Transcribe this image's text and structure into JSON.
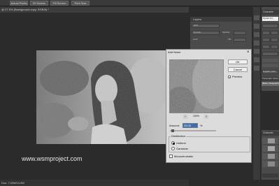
{
  "toolbar": {
    "buttons": [
      "Actual Pixels",
      "Fit Screen",
      "Fill Screen",
      "Print Size"
    ]
  },
  "document": {
    "tab_title": "@ 27.5% (Background copy, RGB/8) *",
    "status": "Doc: 7.02M/14.0M",
    "watermark": "www.wsmproject.com"
  },
  "layers_panel": {
    "tab": "Layers",
    "kind_label": "Kind",
    "blend_mode": "Normal",
    "opacity_label": "Opacity:",
    "lock_label": "Lock:",
    "fill_label": "Fill:"
  },
  "character_panel": {
    "tab": "Character",
    "font": "Myriad Pro",
    "language": "English: USA",
    "paragraph_styles_tab": "Paragraph Styles",
    "basic_paragraph": "[Basic Paragraph]"
  },
  "channels_panel": {
    "tab": "Channels"
  },
  "dialog": {
    "title": "Add Noise",
    "close_glyph": "×",
    "ok_label": "OK",
    "cancel_label": "Cancel",
    "preview_label": "Preview",
    "zoom_level": "100%",
    "zoom_out": "−",
    "zoom_in": "+",
    "amount_label": "Amount:",
    "amount_value": "25.00",
    "amount_unit": "%",
    "amount_fraction": 0.0625,
    "distribution_label": "Distribution",
    "uniform_label": "Uniform",
    "gaussian_label": "Gaussian",
    "monochromatic_label": "Monochromatic"
  }
}
